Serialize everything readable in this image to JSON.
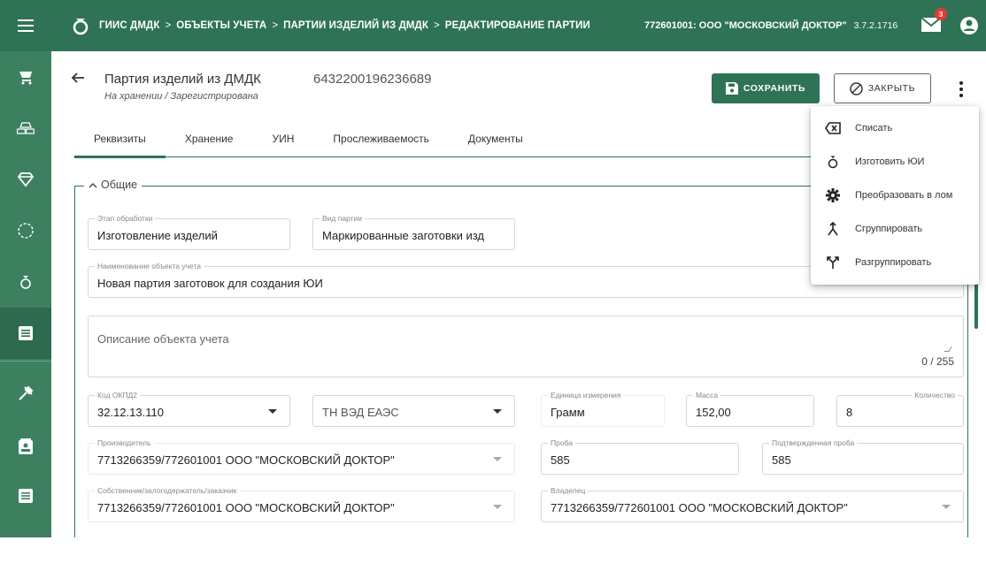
{
  "header": {
    "breadcrumbs": [
      "ГИИС ДМДК",
      "ОБЪЕКТЫ УЧЕТА",
      "ПАРТИИ ИЗДЕЛИЙ ИЗ ДМДК",
      "РЕДАКТИРОВАНИЕ ПАРТИИ"
    ],
    "separator": ">",
    "org": "772601001: ООО \"МОСКОВСКИЙ ДОКТОР\"",
    "version": "3.7.2.1716",
    "notifications_count": "3"
  },
  "page": {
    "title": "Партия изделий из ДМДК",
    "status": "На хранении / Зарегистрирована",
    "batch_number": "6432200196236689",
    "save_label": "СОХРАНИТЬ",
    "close_label": "ЗАКРЫТЬ"
  },
  "tabs": [
    "Реквизиты",
    "Хранение",
    "УИН",
    "Прослеживаемость",
    "Документы"
  ],
  "section": {
    "title": "Общие",
    "fields": {
      "stage": {
        "label": "Этап обработки",
        "value": "Изготовление изделий"
      },
      "batch_type": {
        "label": "Вид партии",
        "value": "Маркированные заготовки изд"
      },
      "object_name": {
        "label": "Наименование объекта учета",
        "value": "Новая партия заготовок для создания ЮИ"
      },
      "description": {
        "placeholder": "Описание объекта учета",
        "counter": "0 / 255"
      },
      "okpd2": {
        "label": "Код ОКПД2",
        "value": "32.12.13.110"
      },
      "tnved": {
        "value": "ТН ВЭД ЕАЭС"
      },
      "unit": {
        "label": "Единица измерения",
        "value": "Грамм"
      },
      "mass": {
        "label": "Масса",
        "value": "152,00"
      },
      "quantity": {
        "label": "Количество",
        "value": "8"
      },
      "manufacturer": {
        "label": "Производитель",
        "value": "7713266359/772601001 ООО \"МОСКОВСКИЙ ДОКТОР\""
      },
      "assay": {
        "label": "Проба",
        "value": "585"
      },
      "confirmed_assay": {
        "label": "Подтвержденная проба",
        "value": "585"
      },
      "owner_pledgee": {
        "label": "Собственник/залогодержатель/заказчик",
        "value": "7713266359/772601001 ООО \"МОСКОВСКИЙ ДОКТОР\""
      },
      "owner": {
        "label": "Владелец",
        "value": "7713266359/772601001 ООО \"МОСКОВСКИЙ ДОКТОР\""
      }
    }
  },
  "menu": {
    "items": [
      {
        "label": "Списать",
        "icon": "backspace-icon"
      },
      {
        "label": "Изготовить ЮИ",
        "icon": "ring-icon"
      },
      {
        "label": "Преобразовать в лом",
        "icon": "gear-icon"
      },
      {
        "label": "Сгруппировать",
        "icon": "merge-icon"
      },
      {
        "label": "Разгруппировать",
        "icon": "split-icon"
      }
    ]
  },
  "colors": {
    "primary": "#2e7356",
    "rail": "#3c8060",
    "badge": "#e53935"
  }
}
